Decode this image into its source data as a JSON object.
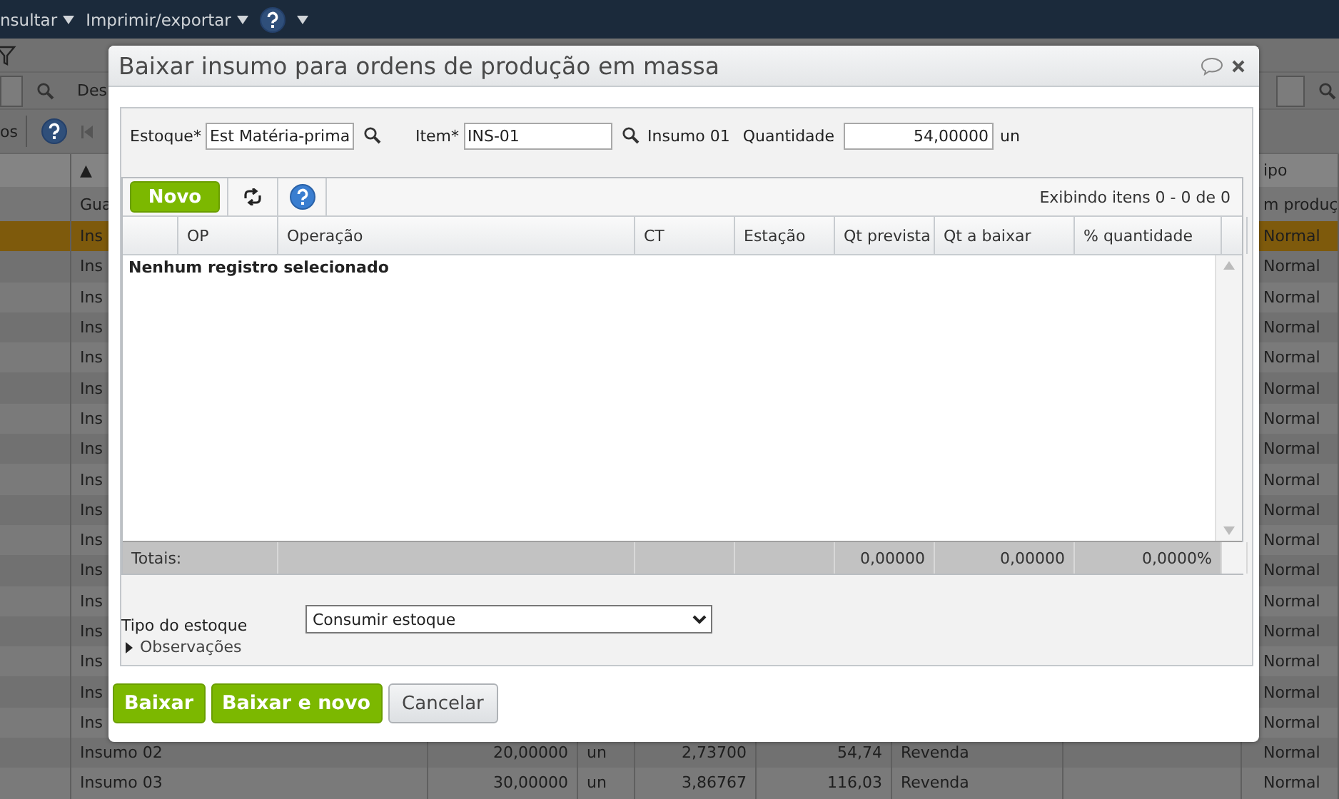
{
  "menu_bar": {
    "items": [
      {
        "label": "nsultar"
      },
      {
        "label": "Imprimir/exportar"
      }
    ]
  },
  "search_row": {
    "left_label": "Des"
  },
  "toolbar": {
    "button_label": "os"
  },
  "table": {
    "rows": [
      {
        "kind": "header",
        "cells": {
          "col_1": "▲",
          "col_8": "ipo"
        }
      },
      {
        "kind": "filter",
        "cells": {
          "col_1": "Gua",
          "col_8": "m produç"
        }
      },
      {
        "kind": "data",
        "selected": true,
        "cells": {
          "col_1": "Ins",
          "col_8": "Normal"
        }
      },
      {
        "kind": "data",
        "selected": false,
        "cells": {
          "col_1": "Ins",
          "col_8": "Normal"
        }
      },
      {
        "kind": "data",
        "selected": false,
        "cells": {
          "col_1": "Ins",
          "col_8": "Normal"
        }
      },
      {
        "kind": "data",
        "selected": false,
        "cells": {
          "col_1": "Ins",
          "col_8": "Normal"
        }
      },
      {
        "kind": "data",
        "selected": false,
        "cells": {
          "col_1": "Ins",
          "col_8": "Normal"
        }
      },
      {
        "kind": "data",
        "selected": false,
        "cells": {
          "col_1": "Ins",
          "col_8": "Normal"
        }
      },
      {
        "kind": "data",
        "selected": false,
        "cells": {
          "col_1": "Ins",
          "col_8": "Normal"
        }
      },
      {
        "kind": "data",
        "selected": false,
        "cells": {
          "col_1": "Ins",
          "col_8": "Normal"
        }
      },
      {
        "kind": "data",
        "selected": false,
        "cells": {
          "col_1": "Ins",
          "col_8": "Normal"
        }
      },
      {
        "kind": "data",
        "selected": false,
        "cells": {
          "col_1": "Ins",
          "col_8": "Normal"
        }
      },
      {
        "kind": "data",
        "selected": false,
        "cells": {
          "col_1": "Ins",
          "col_8": "Normal"
        }
      },
      {
        "kind": "data",
        "selected": false,
        "cells": {
          "col_1": "Ins",
          "col_8": "Normal"
        }
      },
      {
        "kind": "data",
        "selected": false,
        "cells": {
          "col_1": "Ins",
          "col_8": "Normal"
        }
      },
      {
        "kind": "data",
        "selected": false,
        "cells": {
          "col_1": "Ins",
          "col_8": "Normal"
        }
      },
      {
        "kind": "data",
        "selected": false,
        "cells": {
          "col_1": "Ins",
          "col_8": "Normal"
        }
      },
      {
        "kind": "data",
        "selected": false,
        "cells": {
          "col_1": "Ins",
          "col_8": "Normal"
        }
      },
      {
        "kind": "data",
        "selected": false,
        "cells": {
          "col_1": "Ins",
          "col_8": "Normal"
        }
      },
      {
        "kind": "data",
        "selected": false,
        "cells": {
          "col_1": "Insumo 02",
          "col_2": "20,00000",
          "col_3": "un",
          "col_4": "2,73700",
          "col_5": "54,74",
          "col_6": "Revenda",
          "col_8": "Normal"
        }
      },
      {
        "kind": "data",
        "selected": false,
        "cells": {
          "col_1": "Insumo 03",
          "col_2": "30,00000",
          "col_3": "un",
          "col_4": "3,86767",
          "col_5": "116,03",
          "col_6": "Revenda",
          "col_8": "Normal"
        }
      }
    ]
  },
  "dialog": {
    "title": "Baixar insumo para ordens de produção em massa",
    "fields": {
      "estoque": {
        "label": "Estoque*",
        "value": "Est Matéria-prima"
      },
      "item": {
        "label": "Item*",
        "value": "INS-01"
      },
      "item_description": "Insumo 01",
      "quantidade": {
        "label": "Quantidade",
        "value": "54,00000",
        "unit": "un"
      }
    },
    "grid": {
      "new_button": "Novo",
      "paging": "Exibindo itens 0 - 0 de 0",
      "columns": [
        "OP",
        "Operação",
        "CT",
        "Estação",
        "Qt prevista",
        "Qt a baixar",
        "% quantidade"
      ],
      "empty_message": "Nenhum registro selecionado",
      "totals": {
        "label": "Totais:",
        "values": [
          "0,00000",
          "0,00000",
          "0,0000%"
        ]
      }
    },
    "tipo_estoque": {
      "label": "Tipo do estoque",
      "value": "Consumir estoque"
    },
    "observacoes": {
      "label": "Observações",
      "expanded": false
    },
    "buttons": [
      {
        "label": "Baixar",
        "kind": "primary"
      },
      {
        "label": "Baixar e novo",
        "kind": "primary"
      },
      {
        "label": "Cancelar",
        "kind": "secondary"
      }
    ]
  }
}
